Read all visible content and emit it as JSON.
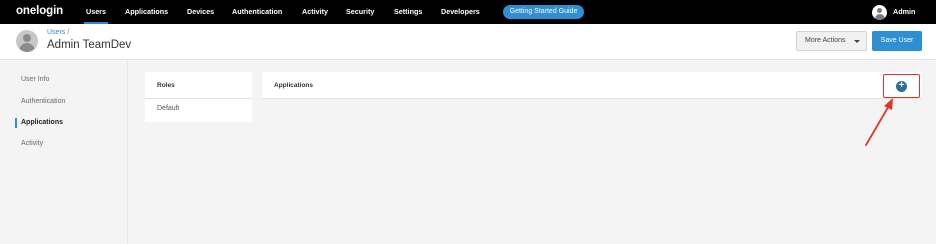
{
  "nav": {
    "logo": "onelogin",
    "items": [
      {
        "label": "Users",
        "active": true
      },
      {
        "label": "Applications"
      },
      {
        "label": "Devices"
      },
      {
        "label": "Authentication"
      },
      {
        "label": "Activity"
      },
      {
        "label": "Security"
      },
      {
        "label": "Settings"
      },
      {
        "label": "Developers"
      }
    ],
    "getting_started": "Getting Started Guide",
    "account": "Admin"
  },
  "header": {
    "breadcrumb": "Users /",
    "title": "Admin TeamDev",
    "more_actions": "More Actions",
    "save_user": "Save User"
  },
  "sidebar": {
    "items": [
      {
        "label": "User Info"
      },
      {
        "label": "Authentication"
      },
      {
        "label": "Applications",
        "active": true
      },
      {
        "label": "Activity"
      }
    ]
  },
  "roles": {
    "header": "Roles",
    "items": [
      "Default"
    ]
  },
  "applications": {
    "header": "Applications",
    "add_icon": "plus-circle-icon"
  },
  "colors": {
    "accent": "#2e8fd3",
    "nav_bg": "#000000",
    "highlight": "#e0342a"
  }
}
